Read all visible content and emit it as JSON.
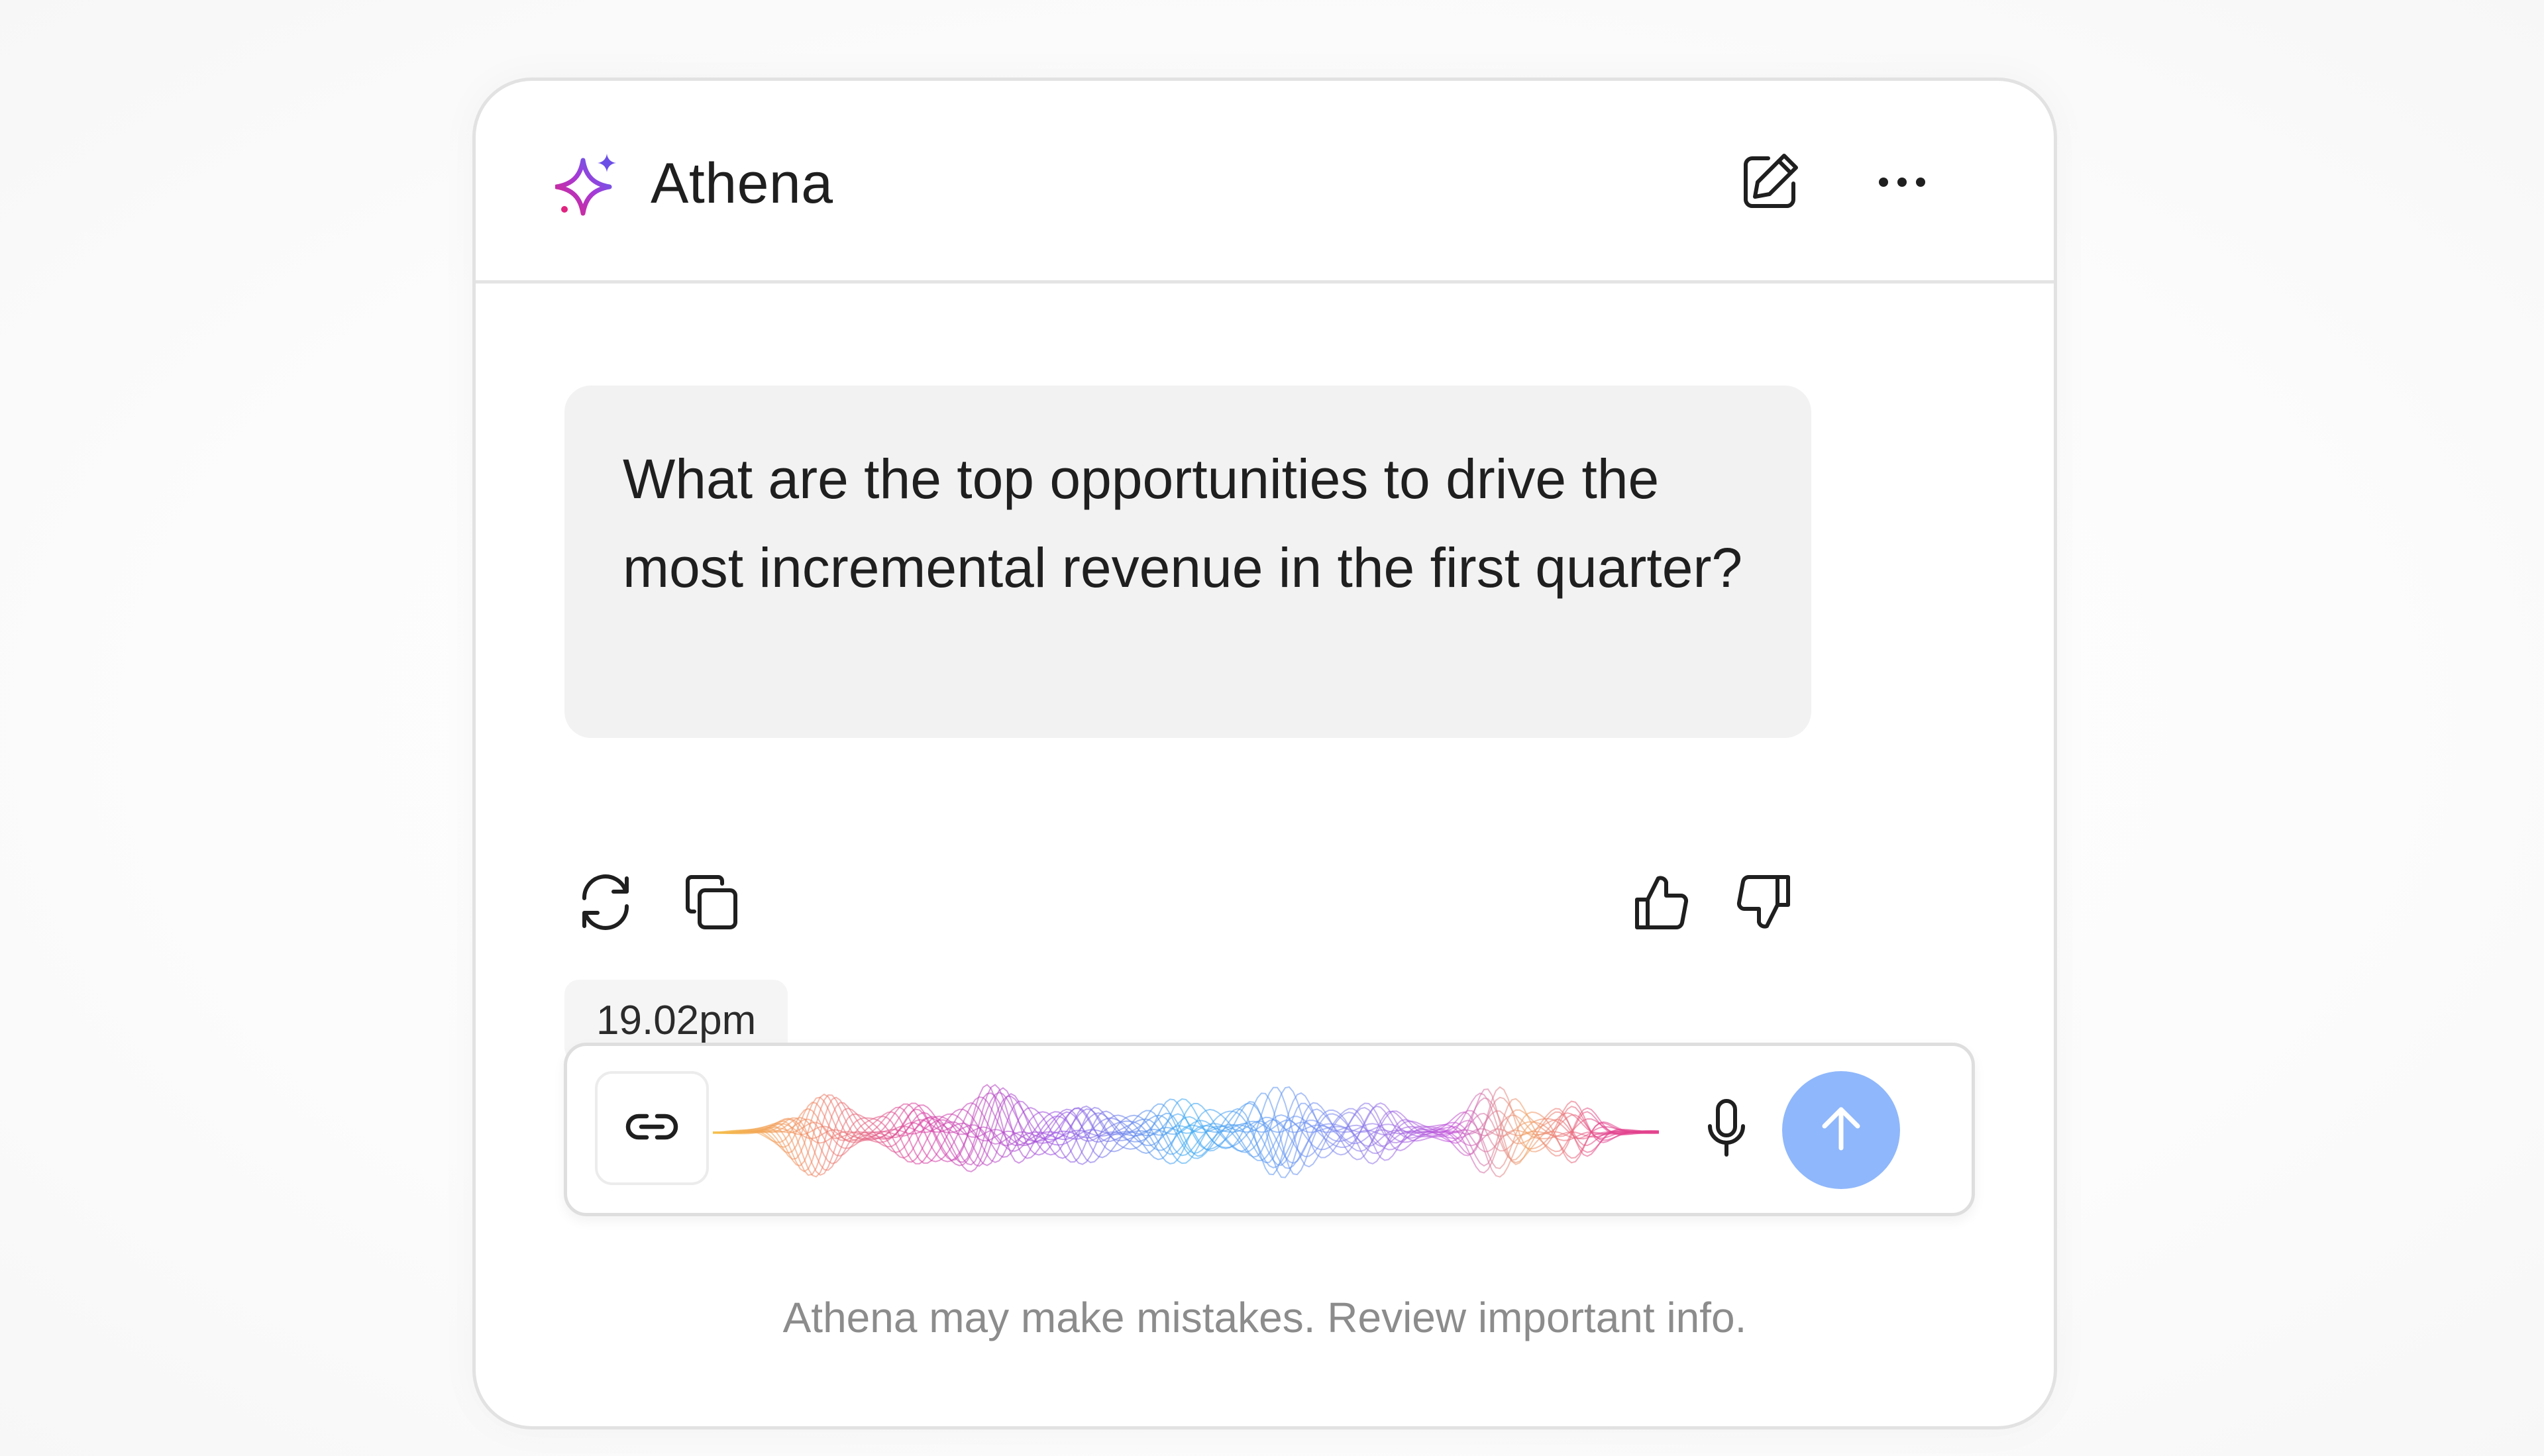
{
  "app": {
    "name": "Athena",
    "brand_colors": [
      "#e0247f",
      "#7b3fe4",
      "#3b82f6"
    ]
  },
  "header": {
    "icons": [
      "sparkle-icon",
      "edit-icon",
      "more-icon"
    ]
  },
  "conversation": {
    "user_message": "What are the top opportunities to drive the most incremental revenue in the first quarter?",
    "timestamp": "19.02pm",
    "actions": [
      "regenerate-icon",
      "copy-icon",
      "thumbs-up-icon",
      "thumbs-down-icon"
    ]
  },
  "composer": {
    "state": "listening",
    "icons": [
      "link-icon",
      "waveform",
      "microphone-icon",
      "arrow-up-icon"
    ],
    "send_color": "#8fb7fb"
  },
  "footer": {
    "disclaimer": "Athena may make mistakes. Review important info."
  }
}
